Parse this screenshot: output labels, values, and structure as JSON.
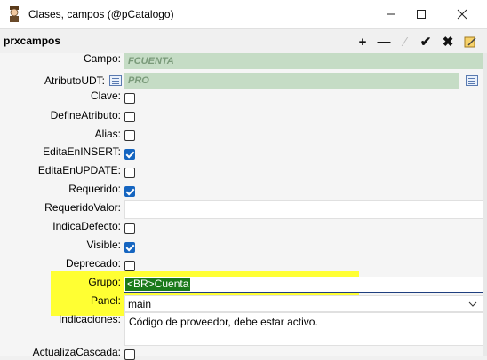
{
  "window": {
    "title": "Clases, campos (@pCatalogo)"
  },
  "toolbar": {
    "title": "prxcampos"
  },
  "form": {
    "campo": {
      "label": "Campo:",
      "value": "FCUENTA"
    },
    "atributo_udt": {
      "label": "AtributoUDT:",
      "value": "PRO"
    },
    "clave": {
      "label": "Clave:",
      "checked": false
    },
    "define_atributo": {
      "label": "DefineAtributo:",
      "checked": false
    },
    "alias": {
      "label": "Alias:",
      "checked": false
    },
    "edita_insert": {
      "label": "EditaEnINSERT:",
      "checked": true
    },
    "edita_update": {
      "label": "EditaEnUPDATE:",
      "checked": false
    },
    "requerido": {
      "label": "Requerido:",
      "checked": true
    },
    "requerido_valor": {
      "label": "RequeridoValor:",
      "value": ""
    },
    "indica_defecto": {
      "label": "IndicaDefecto:",
      "checked": false
    },
    "visible": {
      "label": "Visible:",
      "checked": true
    },
    "deprecado": {
      "label": "Deprecado:",
      "checked": false
    },
    "grupo": {
      "label": "Grupo:",
      "value": "<BR>Cuenta"
    },
    "panel": {
      "label": "Panel:",
      "value": "main"
    },
    "indicaciones": {
      "label": "Indicaciones:",
      "value": "Código de proveedor, debe estar activo."
    },
    "actualiza_cascada": {
      "label": "ActualizaCascada:",
      "checked": false
    }
  },
  "colors": {
    "highlight": "#ffff33",
    "checkbox_on": "#1565c0",
    "readonly_field": "#c5dcc5",
    "selection": "#1a7a1a"
  }
}
